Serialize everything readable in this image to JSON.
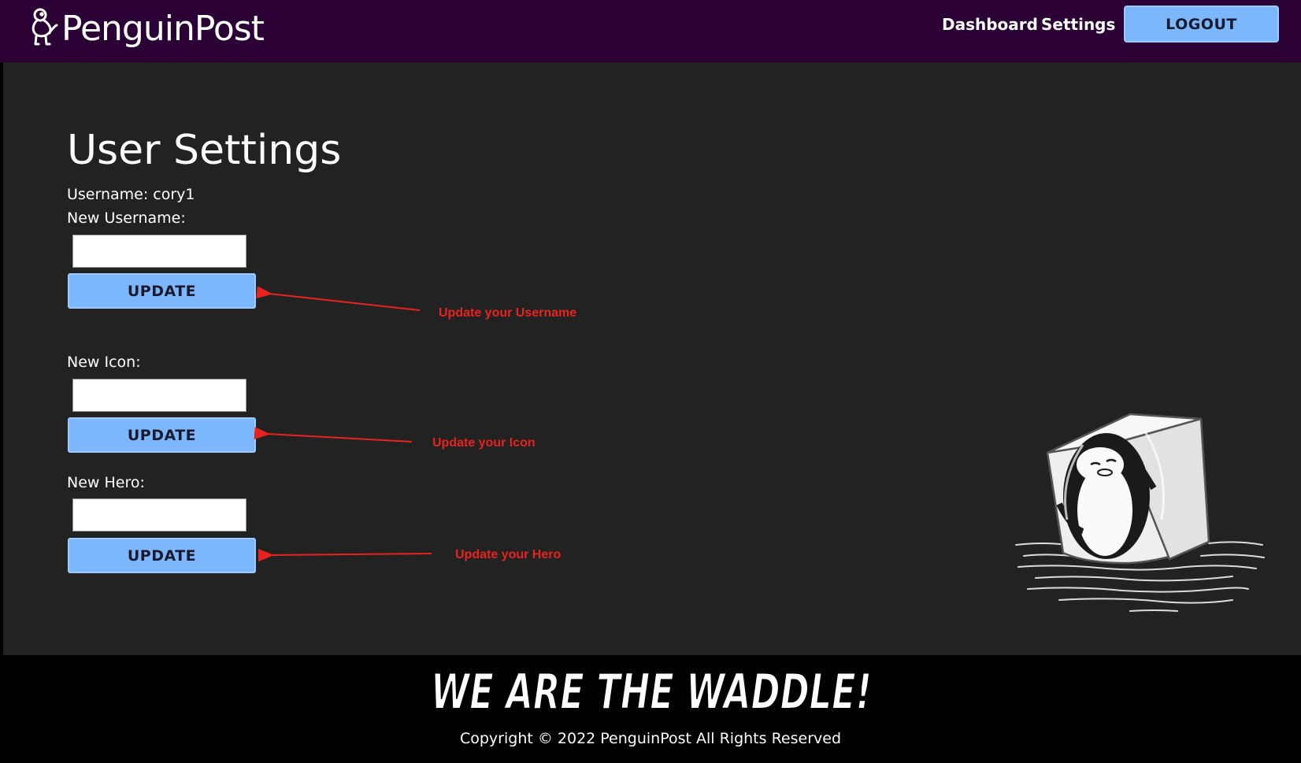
{
  "header": {
    "logo_text": "PenguinPost",
    "nav": {
      "dashboard": "Dashboard",
      "settings": "Settings"
    },
    "logout_label": "LOGOUT"
  },
  "settings": {
    "title": "User Settings",
    "username_line": "Username: cory1",
    "new_username_label": "New Username:",
    "new_icon_label": "New Icon:",
    "new_hero_label": "New Hero:",
    "new_username_value": "",
    "new_icon_value": "",
    "new_hero_value": "",
    "update_label": "UPDATE"
  },
  "annotations": {
    "username": "Update your Username",
    "icon": "Update your Icon",
    "hero": "Update your Hero",
    "color": "#e8231f"
  },
  "footer": {
    "slogan": "WE ARE THE WADDLE!",
    "copyright": "Copyright © 2022 PenguinPost All Rights Reserved"
  },
  "colors": {
    "header_bg": "#2a0035",
    "main_bg": "#222222",
    "button_bg": "#7cb6fb",
    "footer_bg": "#000000"
  }
}
